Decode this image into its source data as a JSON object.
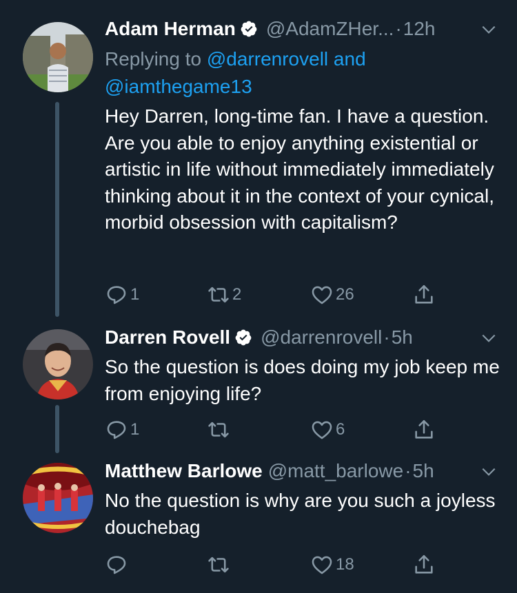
{
  "colors": {
    "background": "#15202b",
    "text": "#ffffff",
    "secondary": "#8899a6",
    "link": "#1da1f2",
    "thread_line": "#3d5466"
  },
  "tweets": [
    {
      "name": "Adam Herman",
      "verified": true,
      "handle": "@AdamZHer...",
      "separator": "·",
      "time": "12h",
      "replying_prefix": "Replying to",
      "replying_mentions": "@darrenrovell and @iamthegame13",
      "text": "Hey Darren, long-time fan. I have a question. Are you able to enjoy anything existential or artistic in life without immediately immediately thinking about it in the context of your cynical, morbid obsession with capitalism?",
      "replies": "1",
      "retweets": "2",
      "likes": "26",
      "avatar_icon": "person-photo"
    },
    {
      "name": "Darren Rovell",
      "verified": true,
      "handle": "@darrenrovell",
      "separator": "·",
      "time": "5h",
      "text": "So the question is does doing my job keep me from enjoying life?",
      "replies": "1",
      "retweets": "",
      "likes": "6",
      "avatar_icon": "person-photo"
    },
    {
      "name": "Matthew Barlowe",
      "verified": false,
      "handle": "@matt_barlowe",
      "separator": "·",
      "time": "5h",
      "text": "No the question is why are you such a joyless douchebag",
      "replies": "",
      "retweets": "",
      "likes": "18",
      "avatar_icon": "album-art"
    }
  ]
}
